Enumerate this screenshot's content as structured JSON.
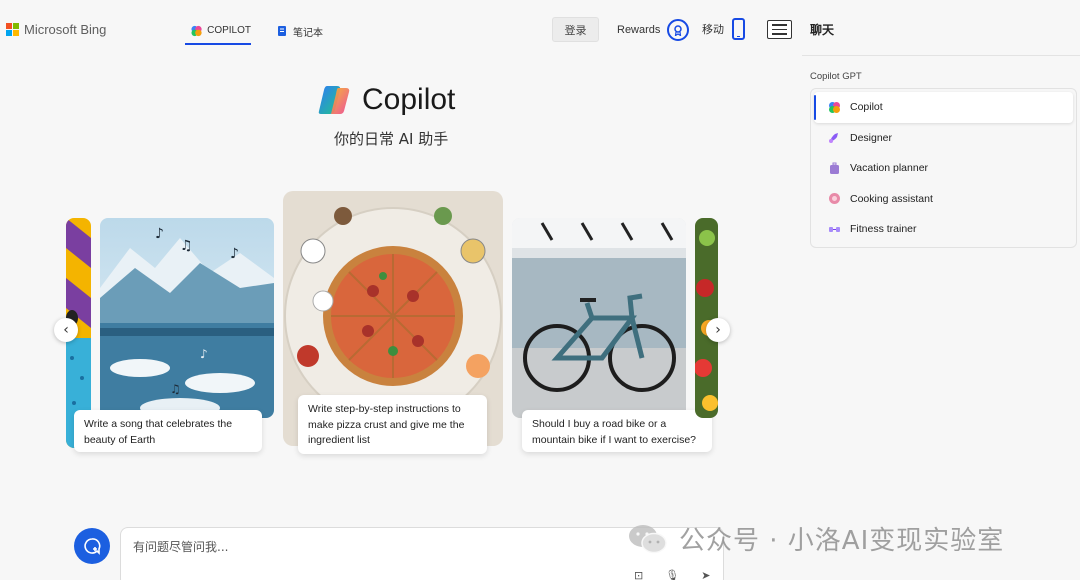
{
  "header": {
    "brand": "Microsoft Bing",
    "tabs": [
      {
        "label": "COPILOT",
        "active": true
      },
      {
        "label": "笔记本",
        "active": false
      }
    ],
    "login_label": "登录",
    "rewards_label": "Rewards",
    "mobile_label": "移动",
    "chat_label": "聊天"
  },
  "hero": {
    "title": "Copilot",
    "subtitle": "你的日常 AI 助手"
  },
  "carousel": {
    "cards": [
      {
        "caption": "Write a song that celebrates the beauty of Earth",
        "image": "icebergs-music-notes"
      },
      {
        "caption": "Write step-by-step instructions to make pizza crust and give me the ingredient list",
        "image": "pizza-ingredients"
      },
      {
        "caption": "Should I buy a road bike or a mountain bike if I want to exercise?",
        "image": "road-bike"
      }
    ],
    "prev_icon": "chevron-left-icon",
    "next_icon": "chevron-right-icon"
  },
  "gpt_panel": {
    "title": "Copilot GPT",
    "items": [
      {
        "label": "Copilot",
        "active": true,
        "icon": "copilot-icon",
        "color": "#3b82f6"
      },
      {
        "label": "Designer",
        "active": false,
        "icon": "designer-icon",
        "color": "#8b5cf6"
      },
      {
        "label": "Vacation planner",
        "active": false,
        "icon": "luggage-icon",
        "color": "#9b7bd4"
      },
      {
        "label": "Cooking assistant",
        "active": false,
        "icon": "cooking-icon",
        "color": "#e88aa8"
      },
      {
        "label": "Fitness trainer",
        "active": false,
        "icon": "dumbbell-icon",
        "color": "#a78bfa"
      }
    ]
  },
  "input": {
    "placeholder": "有问题尽管问我..."
  },
  "watermark": {
    "text": "公众号 · 小洛AI变现实验室"
  },
  "colors": {
    "accent": "#174ae4",
    "background": "#f7f7f7"
  }
}
